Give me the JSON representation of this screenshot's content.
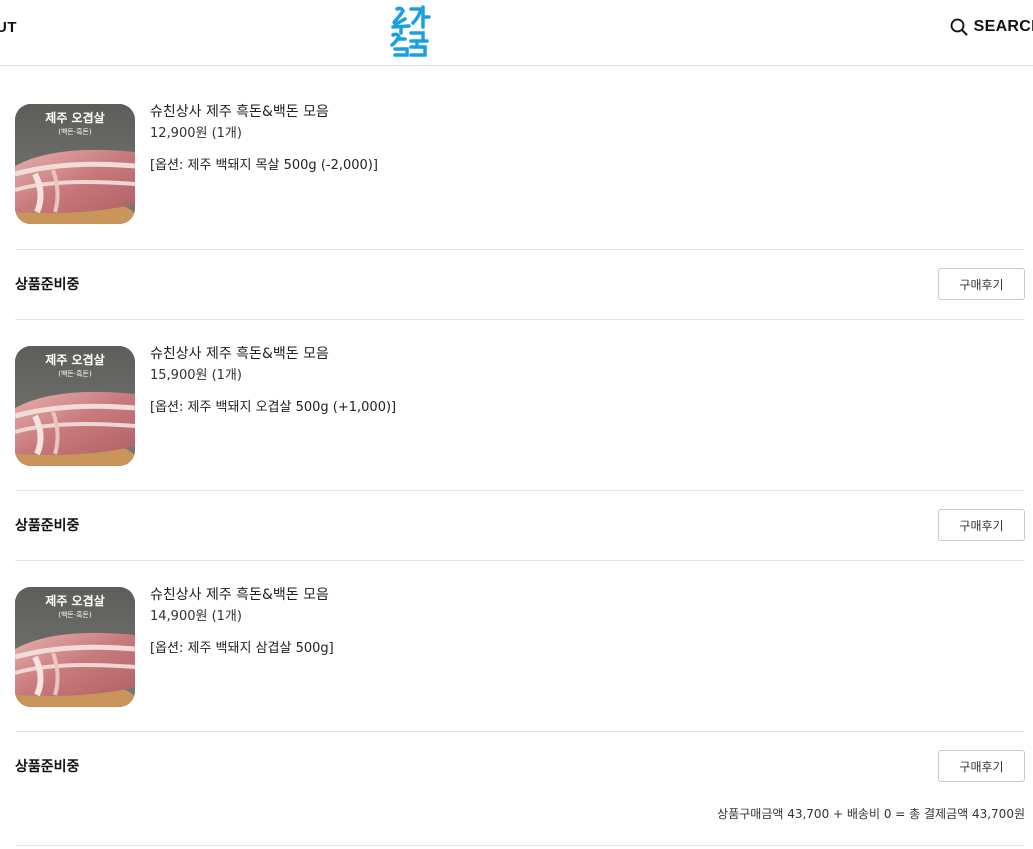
{
  "header": {
    "left_nav": "UT",
    "logo_text": "슈친상사",
    "search_label": "SEARCH"
  },
  "orders": [
    {
      "name": "슈친상사 제주 흑돈&백돈 모음",
      "price": "12,900원 (1개)",
      "option": "[옵션: 제주 백돼지 목살 500g (-2,000)]",
      "thumb_text": "제주 오겹살",
      "thumb_sub": "(백돈·흑돈)",
      "status": "상품준비중",
      "review_label": "구매후기"
    },
    {
      "name": "슈친상사 제주 흑돈&백돈 모음",
      "price": "15,900원 (1개)",
      "option": "[옵션: 제주 백돼지 오겹살 500g (+1,000)]",
      "thumb_text": "제주 오겹살",
      "thumb_sub": "(백돈·흑돈)",
      "status": "상품준비중",
      "review_label": "구매후기"
    },
    {
      "name": "슈친상사 제주 흑돈&백돈 모음",
      "price": "14,900원 (1개)",
      "option": "[옵션: 제주 백돼지 삼겹살 500g]",
      "thumb_text": "제주 오겹살",
      "thumb_sub": "(백돈·흑돈)",
      "status": "상품준비중",
      "review_label": "구매후기"
    }
  ],
  "summary": "상품구매금액 43,700 + 배송비 0 =  총 결제금액 43,700원"
}
